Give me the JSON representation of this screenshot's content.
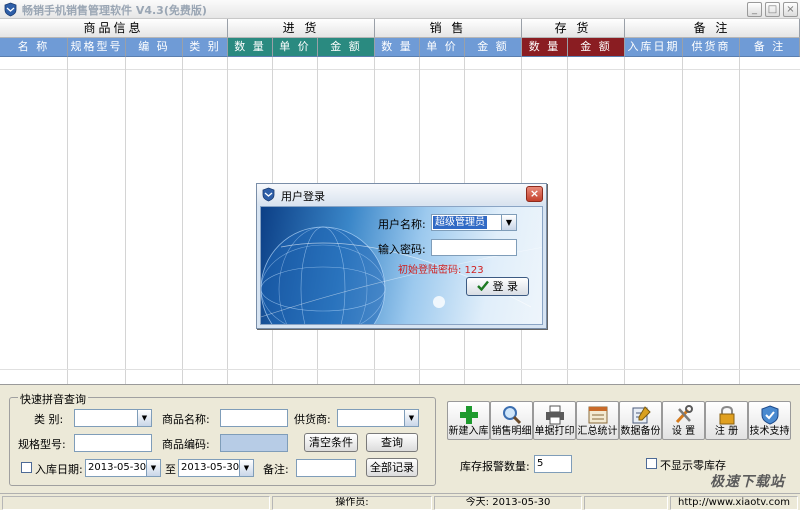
{
  "window": {
    "title": "畅销手机销售管理软件 V4.3(免费版)",
    "controls": [
      "_",
      "□",
      "×"
    ]
  },
  "grid": {
    "groups": [
      {
        "label": "商品信息",
        "color": "#ffffff"
      },
      {
        "label": "进 货",
        "color": "#ffffff"
      },
      {
        "label": "销 售",
        "color": "#ffffff"
      },
      {
        "label": "存 货",
        "color": "#ffffff"
      },
      {
        "label": "备 注",
        "color": "#ffffff"
      }
    ],
    "columns": [
      {
        "label": "名 称"
      },
      {
        "label": "规格型号"
      },
      {
        "label": "编 码"
      },
      {
        "label": "类 别"
      },
      {
        "label": "数 量"
      },
      {
        "label": "单 价"
      },
      {
        "label": "金 额"
      },
      {
        "label": "数 量"
      },
      {
        "label": "单 价"
      },
      {
        "label": "金 额"
      },
      {
        "label": "数 量"
      },
      {
        "label": "金 额"
      },
      {
        "label": "入库日期"
      },
      {
        "label": "供货商"
      },
      {
        "label": "备 注"
      }
    ],
    "header_colors": {
      "default": "#6f9bd6",
      "purchase": "#2a8a80",
      "stock": "#8a1d22"
    }
  },
  "login_dialog": {
    "title": "用户登录",
    "username_label": "用户名称:",
    "username_value": "超级管理员",
    "password_label": "输入密码:",
    "password_value": "",
    "hint": "初始登陆密码: 123",
    "login_button": "登 录",
    "close_button": "×"
  },
  "quick_search": {
    "legend": "快速拼音查询",
    "category_label": "类  别:",
    "category_value": "",
    "product_name_label": "商品名称:",
    "product_name_value": "",
    "supplier_label": "供货商:",
    "supplier_value": "",
    "model_label": "规格型号:",
    "model_value": "",
    "product_code_label": "商品编码:",
    "product_code_value": "",
    "clear_button": "清空条件",
    "search_button": "查询",
    "date_label": "入库日期:",
    "date_from": "2013-05-30",
    "date_separator": "至",
    "date_to": "2013-05-30",
    "remark_label": "备注:",
    "remark_value": "",
    "all_records_button": "全部记录"
  },
  "toolbar": {
    "buttons": [
      {
        "label": "新建入库",
        "icon": "plus-icon"
      },
      {
        "label": "销售明细",
        "icon": "magnifier-icon"
      },
      {
        "label": "单据打印",
        "icon": "printer-icon"
      },
      {
        "label": "汇总统计",
        "icon": "calendar-icon"
      },
      {
        "label": "数据备份",
        "icon": "backup-icon"
      },
      {
        "label": "设 置",
        "icon": "tools-icon"
      },
      {
        "label": "注 册",
        "icon": "lock-icon"
      },
      {
        "label": "技术支持",
        "icon": "shield-icon"
      }
    ]
  },
  "stock_alert": {
    "label": "库存报警数量:",
    "value": "5",
    "hide_zero_label": "不显示零库存",
    "hide_zero_checked": false
  },
  "statusbar": {
    "operator": "操作员:",
    "today": "今天: 2013-05-30",
    "url": "http://www.xiaotv.com"
  },
  "watermark": "极速下载站"
}
